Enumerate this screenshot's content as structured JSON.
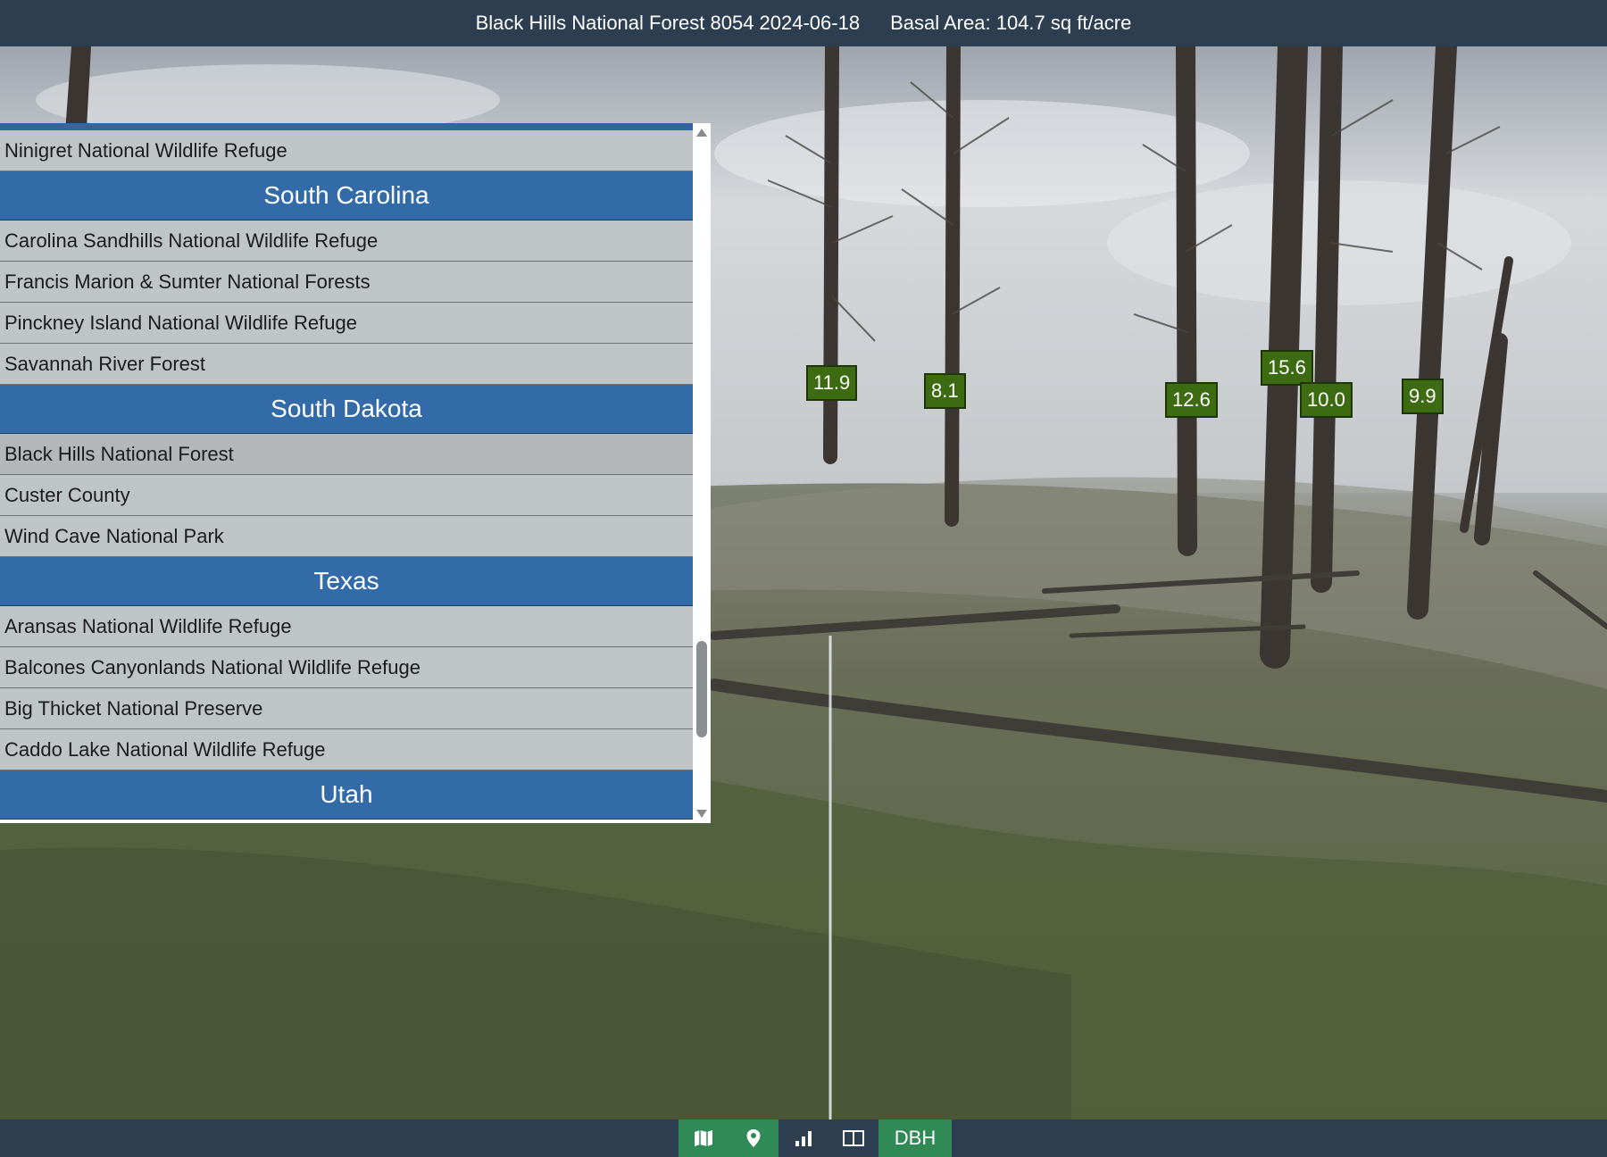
{
  "header": {
    "title": "Black Hills National Forest 8054 2024-06-18",
    "basal_area": "Basal Area: 104.7 sq ft/acre"
  },
  "tree_labels": [
    "11.9",
    "8.1",
    "12.6",
    "15.6",
    "10.0",
    "9.9"
  ],
  "location_list": {
    "rows": [
      {
        "type": "item",
        "label": "Ninigret National Wildlife Refuge"
      },
      {
        "type": "header",
        "label": "South Carolina"
      },
      {
        "type": "item",
        "label": "Carolina Sandhills National Wildlife Refuge"
      },
      {
        "type": "item",
        "label": "Francis Marion & Sumter National Forests"
      },
      {
        "type": "item",
        "label": "Pinckney Island National Wildlife Refuge"
      },
      {
        "type": "item",
        "label": "Savannah River Forest"
      },
      {
        "type": "header",
        "label": "South Dakota"
      },
      {
        "type": "item",
        "label": "Black Hills National Forest",
        "selected": true
      },
      {
        "type": "item",
        "label": "Custer County"
      },
      {
        "type": "item",
        "label": "Wind Cave National Park"
      },
      {
        "type": "header",
        "label": "Texas"
      },
      {
        "type": "item",
        "label": "Aransas National Wildlife Refuge"
      },
      {
        "type": "item",
        "label": "Balcones Canyonlands National Wildlife Refuge"
      },
      {
        "type": "item",
        "label": "Big Thicket National Preserve"
      },
      {
        "type": "item",
        "label": "Caddo Lake National Wildlife Refuge"
      },
      {
        "type": "header",
        "label": "Utah"
      }
    ]
  },
  "toolbar": {
    "buttons": [
      {
        "name": "map-button",
        "icon": "map-icon"
      },
      {
        "name": "location-button",
        "icon": "map-pin-icon"
      },
      {
        "name": "chart-button",
        "icon": "bar-chart-icon"
      },
      {
        "name": "split-view-button",
        "icon": "split-view-icon"
      }
    ],
    "dbh_label": "DBH"
  },
  "colors": {
    "header_bar": "#2c3e4f",
    "state_header": "#336ba8",
    "list_item": "#bfc4c6",
    "dbh_label": "#3c6b12",
    "toolbar_active": "#2f8a56"
  }
}
